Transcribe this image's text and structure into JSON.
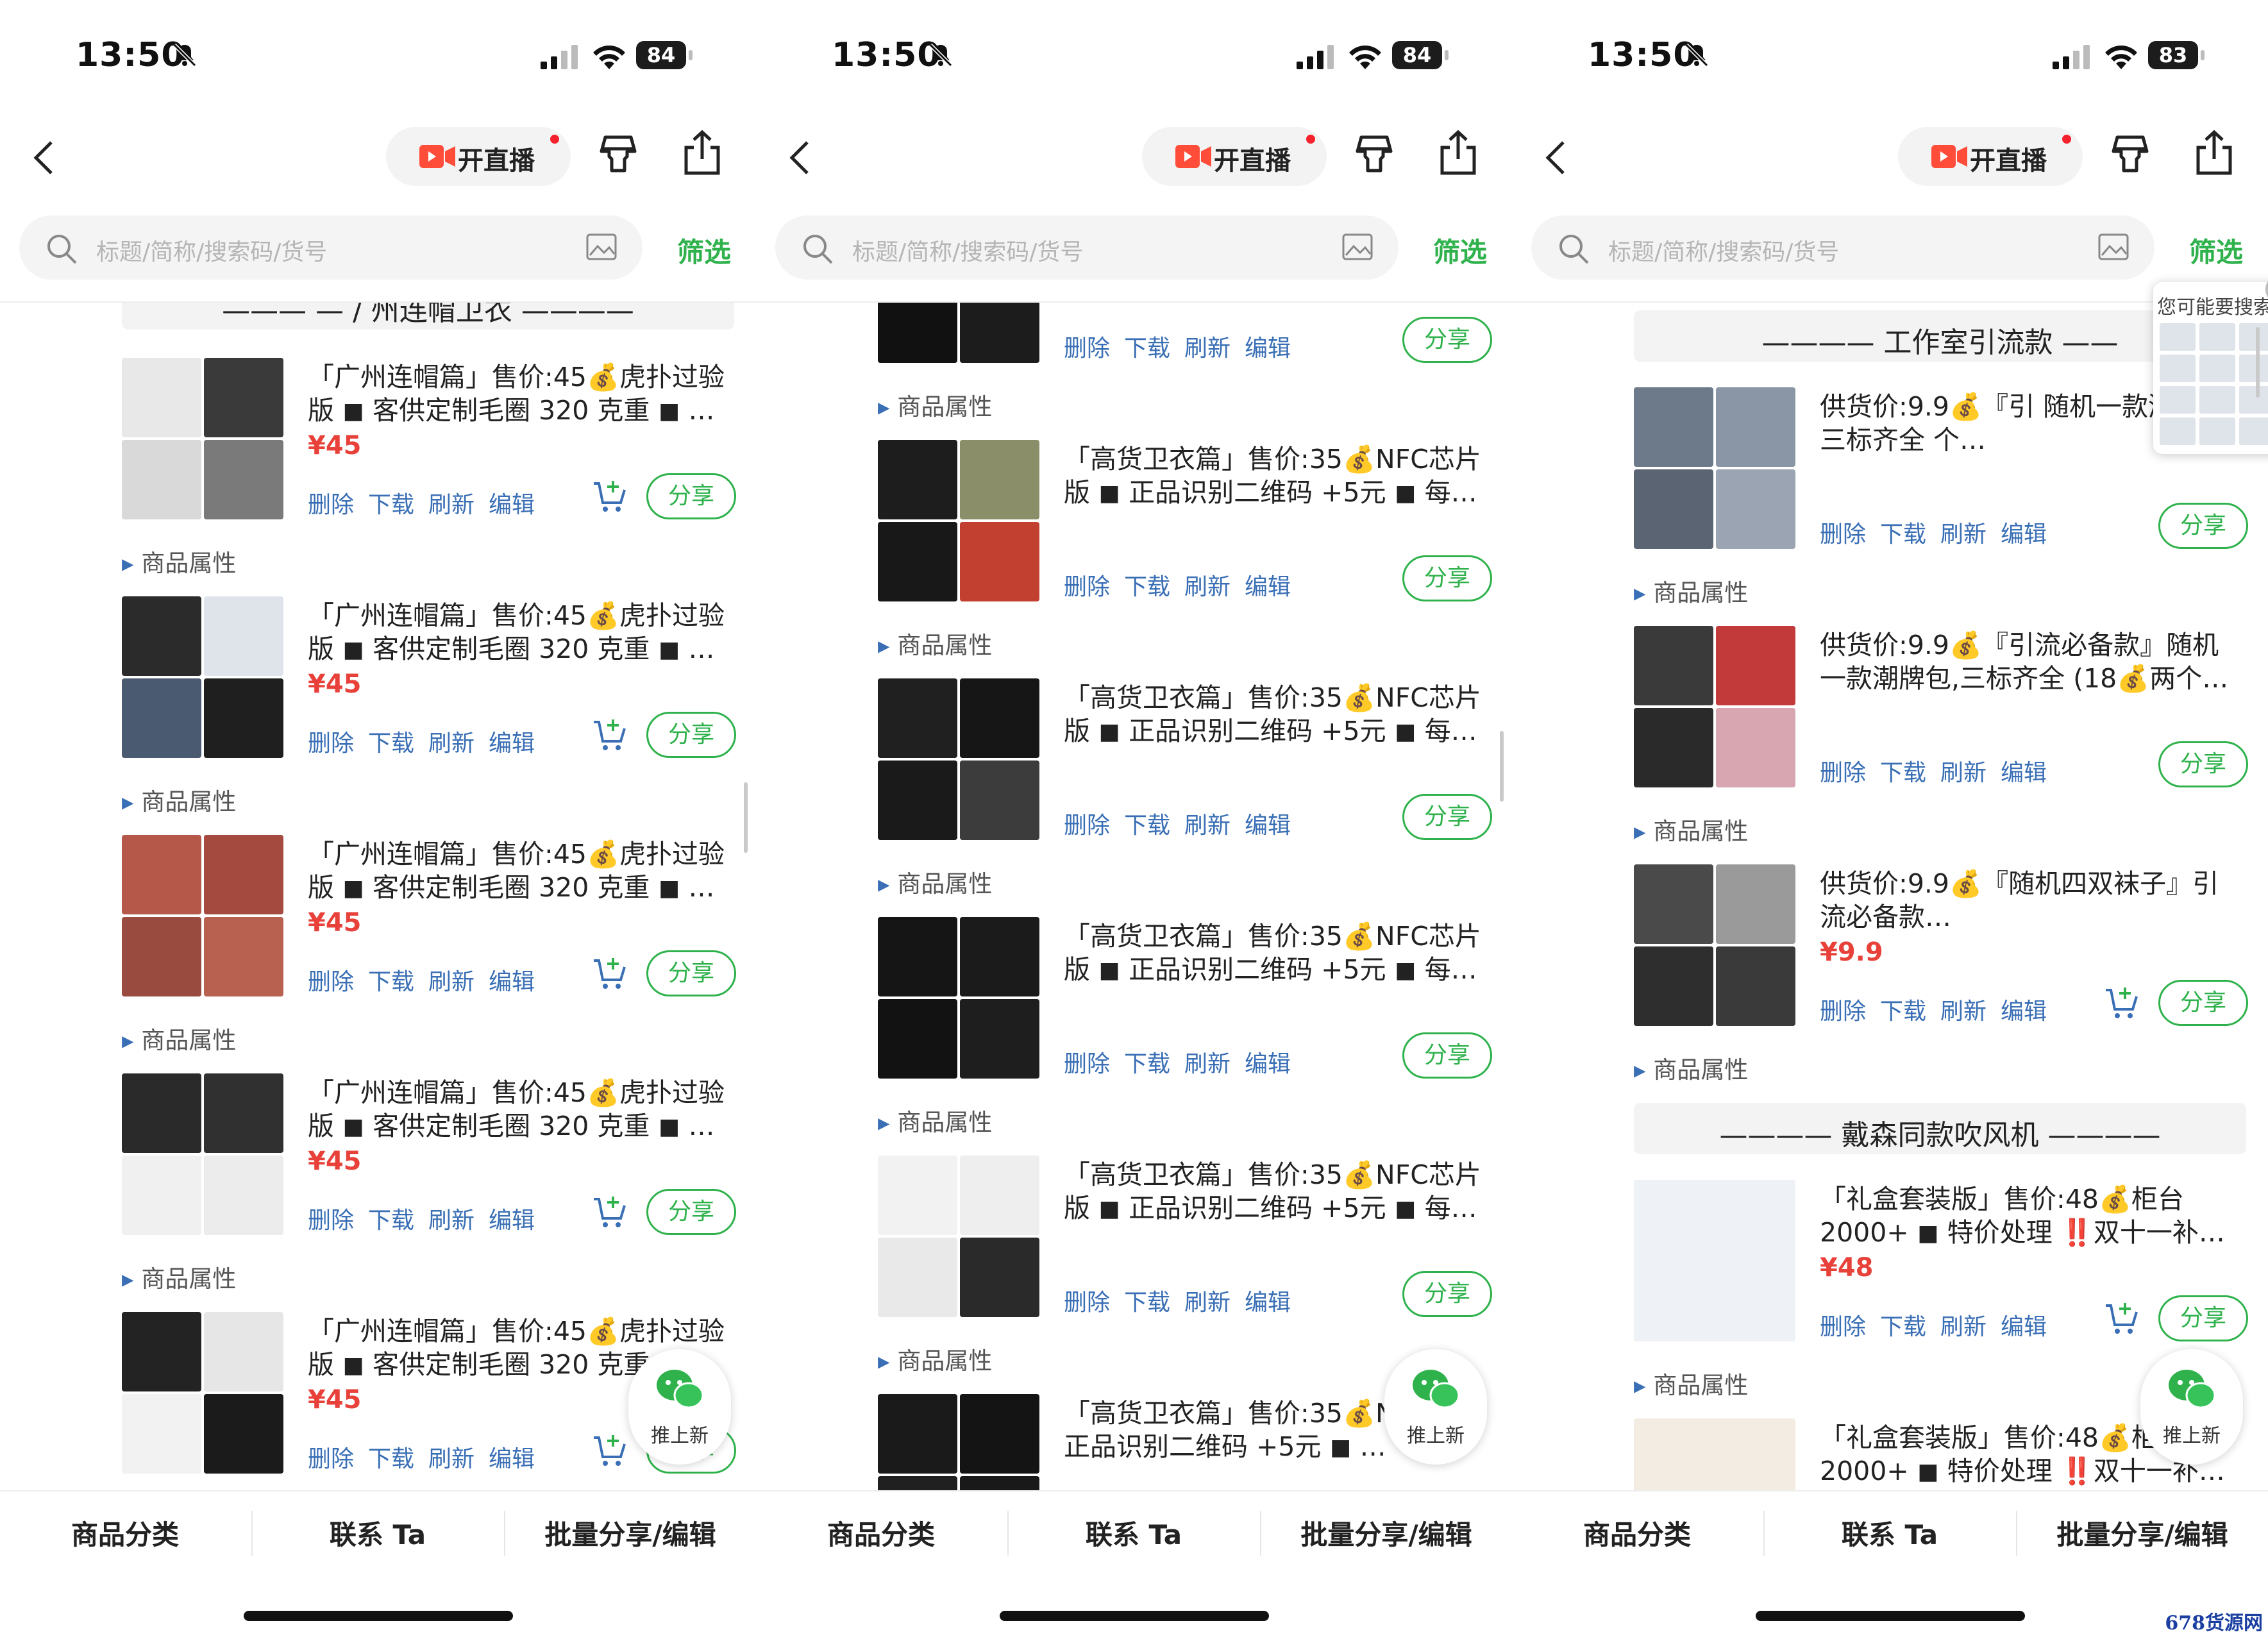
{
  "status": {
    "time": "13:50",
    "battery": [
      "84",
      "84",
      "83"
    ]
  },
  "nav": {
    "live_label": "开直播"
  },
  "search": {
    "placeholder": "标题/简称/搜索码/货号",
    "filter_label": "筛选"
  },
  "actions": {
    "delete": "删除",
    "download": "下载",
    "refresh": "刷新",
    "edit": "编辑",
    "share": "分享",
    "attr": "商品属性"
  },
  "bottom": {
    "category": "商品分类",
    "contact": "联系 Ta",
    "batch": "批量分享/编辑"
  },
  "fab": {
    "label": "推上新"
  },
  "colors": {
    "accent": "#2fb24c",
    "price": "#e8413a",
    "link": "#3a6fb5"
  },
  "icons": [
    "bell-slash-icon",
    "signal-icon",
    "wifi-icon",
    "battery-icon",
    "back-icon",
    "live-camera-icon",
    "shirt-icon",
    "share-icon",
    "search-icon",
    "image-search-icon",
    "cart-add-icon",
    "wechat-icon",
    "close-icon"
  ],
  "panels": [
    {
      "group_header": "——— — / 州连帽卫衣 ————",
      "items": [
        {
          "title": "「广州连帽篇」售价:45💰虎扑过验版 ◼ 客供定制毛圈 320 克重 ◼ …",
          "price": "¥45"
        },
        {
          "title": "「广州连帽篇」售价:45💰虎扑过验版 ◼ 客供定制毛圈 320 克重 ◼ …",
          "price": "¥45"
        },
        {
          "title": "「广州连帽篇」售价:45💰虎扑过验版 ◼ 客供定制毛圈 320 克重 ◼ …",
          "price": "¥45"
        },
        {
          "title": "「广州连帽篇」售价:45💰虎扑过验版 ◼ 客供定制毛圈 320 克重 ◼ …",
          "price": "¥45"
        },
        {
          "title": "「广州连帽篇」售价:45💰虎扑过验版 ◼ 客供定制毛圈 320 克重",
          "price": "¥45"
        }
      ]
    },
    {
      "items": [
        {
          "title": "",
          "price": ""
        },
        {
          "title": "「高货卫衣篇」售价:35💰NFC芯片版 ◼ 正品识别二维码 +5元 ◼ 每…",
          "price": ""
        },
        {
          "title": "「高货卫衣篇」售价:35💰NFC芯片版 ◼ 正品识别二维码 +5元 ◼ 每…",
          "price": ""
        },
        {
          "title": "「高货卫衣篇」售价:35💰NFC芯片版 ◼ 正品识别二维码 +5元 ◼ 每…",
          "price": ""
        },
        {
          "title": "「高货卫衣篇」售价:35💰NFC芯片版 ◼ 正品识别二维码 +5元 ◼ 每…",
          "price": ""
        },
        {
          "title": "「高货卫衣篇」售价:35💰N 版 ◼ 正品识别二维码 +5元 ◼ …",
          "price": ""
        }
      ]
    },
    {
      "group_header": "———— 工作室引流款 ——",
      "group_header2": "———— 戴森同款吹风机 ————",
      "tooltip": "您可能要搜索",
      "items": [
        {
          "title": "供货价:9.9💰『引 随机一款潮牌包,三标齐全 个…",
          "price": ""
        },
        {
          "title": "供货价:9.9💰『引流必备款』随机一款潮牌包,三标齐全 (18💰两个…",
          "price": ""
        },
        {
          "title": "供货价:9.9💰『随机四双袜子』引流必备款…",
          "price": "¥9.9"
        },
        {
          "title": "「礼盒套装版」售价:48💰柜台2000+ ◼ 特价处理 ‼️双十一补…",
          "price": "¥48"
        },
        {
          "title": "「礼盒套装版」售价:48💰柜 2000+ ◼ 特价处理 ‼️双十一补…",
          "price": ""
        }
      ]
    }
  ],
  "watermark": "678货源网"
}
